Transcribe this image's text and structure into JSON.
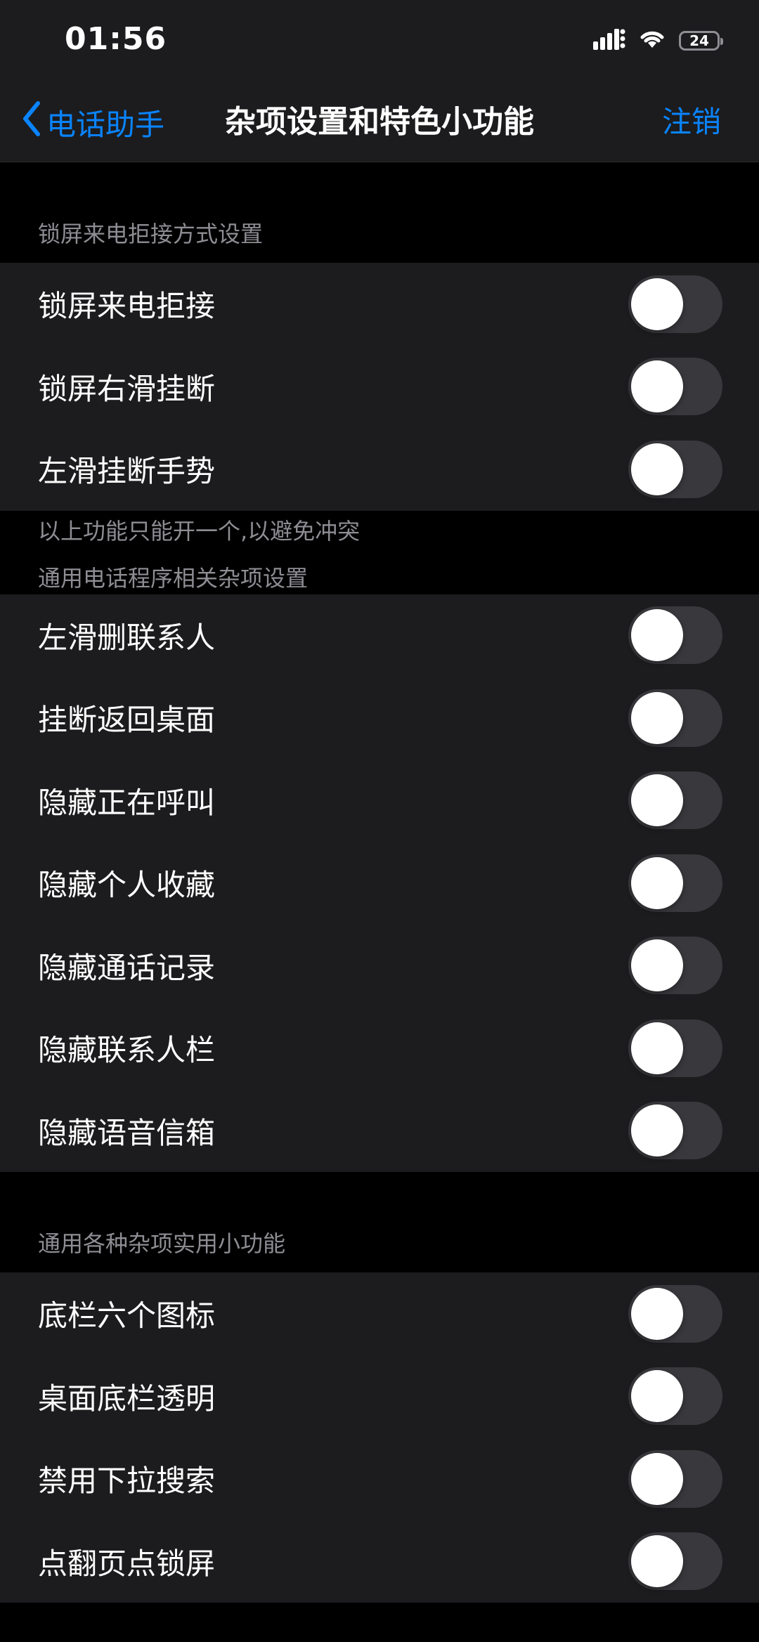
{
  "status_bar": {
    "time": "01:56",
    "battery": "24",
    "icons": [
      "cellular-signal-icon",
      "wifi-icon",
      "battery-icon"
    ]
  },
  "nav": {
    "back_label": "电话助手",
    "title": "杂项设置和特色小功能",
    "action_label": "注销"
  },
  "colors": {
    "accent": "#0a84ff",
    "background": "#000000",
    "group_background": "#1c1c1e",
    "secondary_text": "#8d8d93",
    "toggle_off": "#39393d"
  },
  "sections": [
    {
      "header": "锁屏来电拒接方式设置",
      "footer": "以上功能只能开一个,以避免冲突",
      "items": [
        {
          "label": "锁屏来电拒接",
          "enabled": false
        },
        {
          "label": "锁屏右滑挂断",
          "enabled": false
        },
        {
          "label": "左滑挂断手势",
          "enabled": false
        }
      ]
    },
    {
      "header": "通用电话程序相关杂项设置",
      "items": [
        {
          "label": "左滑删联系人",
          "enabled": false
        },
        {
          "label": "挂断返回桌面",
          "enabled": false
        },
        {
          "label": "隐藏正在呼叫",
          "enabled": false
        },
        {
          "label": "隐藏个人收藏",
          "enabled": false
        },
        {
          "label": "隐藏通话记录",
          "enabled": false
        },
        {
          "label": "隐藏联系人栏",
          "enabled": false
        },
        {
          "label": "隐藏语音信箱",
          "enabled": false
        }
      ]
    },
    {
      "header": "通用各种杂项实用小功能",
      "items": [
        {
          "label": "底栏六个图标",
          "enabled": false
        },
        {
          "label": "桌面底栏透明",
          "enabled": false
        },
        {
          "label": "禁用下拉搜索",
          "enabled": false
        },
        {
          "label": "点翻页点锁屏",
          "enabled": false
        }
      ]
    }
  ]
}
